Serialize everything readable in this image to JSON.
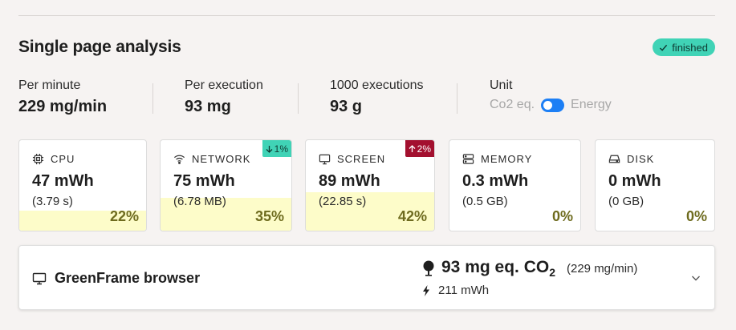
{
  "section": {
    "title": "Single page analysis",
    "status": "finished"
  },
  "summary": [
    {
      "label": "Per minute",
      "value": "229 mg/min"
    },
    {
      "label": "Per execution",
      "value": "93 mg"
    },
    {
      "label": "1000 executions",
      "value": "93 g"
    }
  ],
  "unit": {
    "label": "Unit",
    "option_left": "Co2 eq.",
    "option_right": "Energy",
    "selected": "Co2 eq."
  },
  "cards": [
    {
      "name": "CPU",
      "value": "47 mWh",
      "sub": "(3.79 s)",
      "percent": "22%",
      "share": 0.22,
      "icon": "cpu-icon"
    },
    {
      "name": "NETWORK",
      "value": "75 mWh",
      "sub": "(6.78 MB)",
      "percent": "35%",
      "share": 0.35,
      "icon": "wifi-icon",
      "trend": "1%",
      "trend_dir": "down"
    },
    {
      "name": "SCREEN",
      "value": "89 mWh",
      "sub": "(22.85 s)",
      "percent": "42%",
      "share": 0.42,
      "icon": "monitor-icon",
      "trend": "2%",
      "trend_dir": "up"
    },
    {
      "name": "MEMORY",
      "value": "0.3 mWh",
      "sub": "(0.5 GB)",
      "percent": "0%",
      "share": 0,
      "icon": "memory-icon"
    },
    {
      "name": "DISK",
      "value": "0 mWh",
      "sub": "(0 GB)",
      "percent": "0%",
      "share": 0,
      "icon": "disk-icon"
    }
  ],
  "browser": {
    "name": "GreenFrame browser",
    "co2_value": "93 mg eq. CO",
    "co2_sub": "2",
    "rate": "(229 mg/min)",
    "energy": "211 mWh"
  },
  "colors": {
    "accent": "#1d7ff5",
    "success": "#40d3b6",
    "danger": "#a3102f",
    "fill": "#fdfcc9"
  }
}
